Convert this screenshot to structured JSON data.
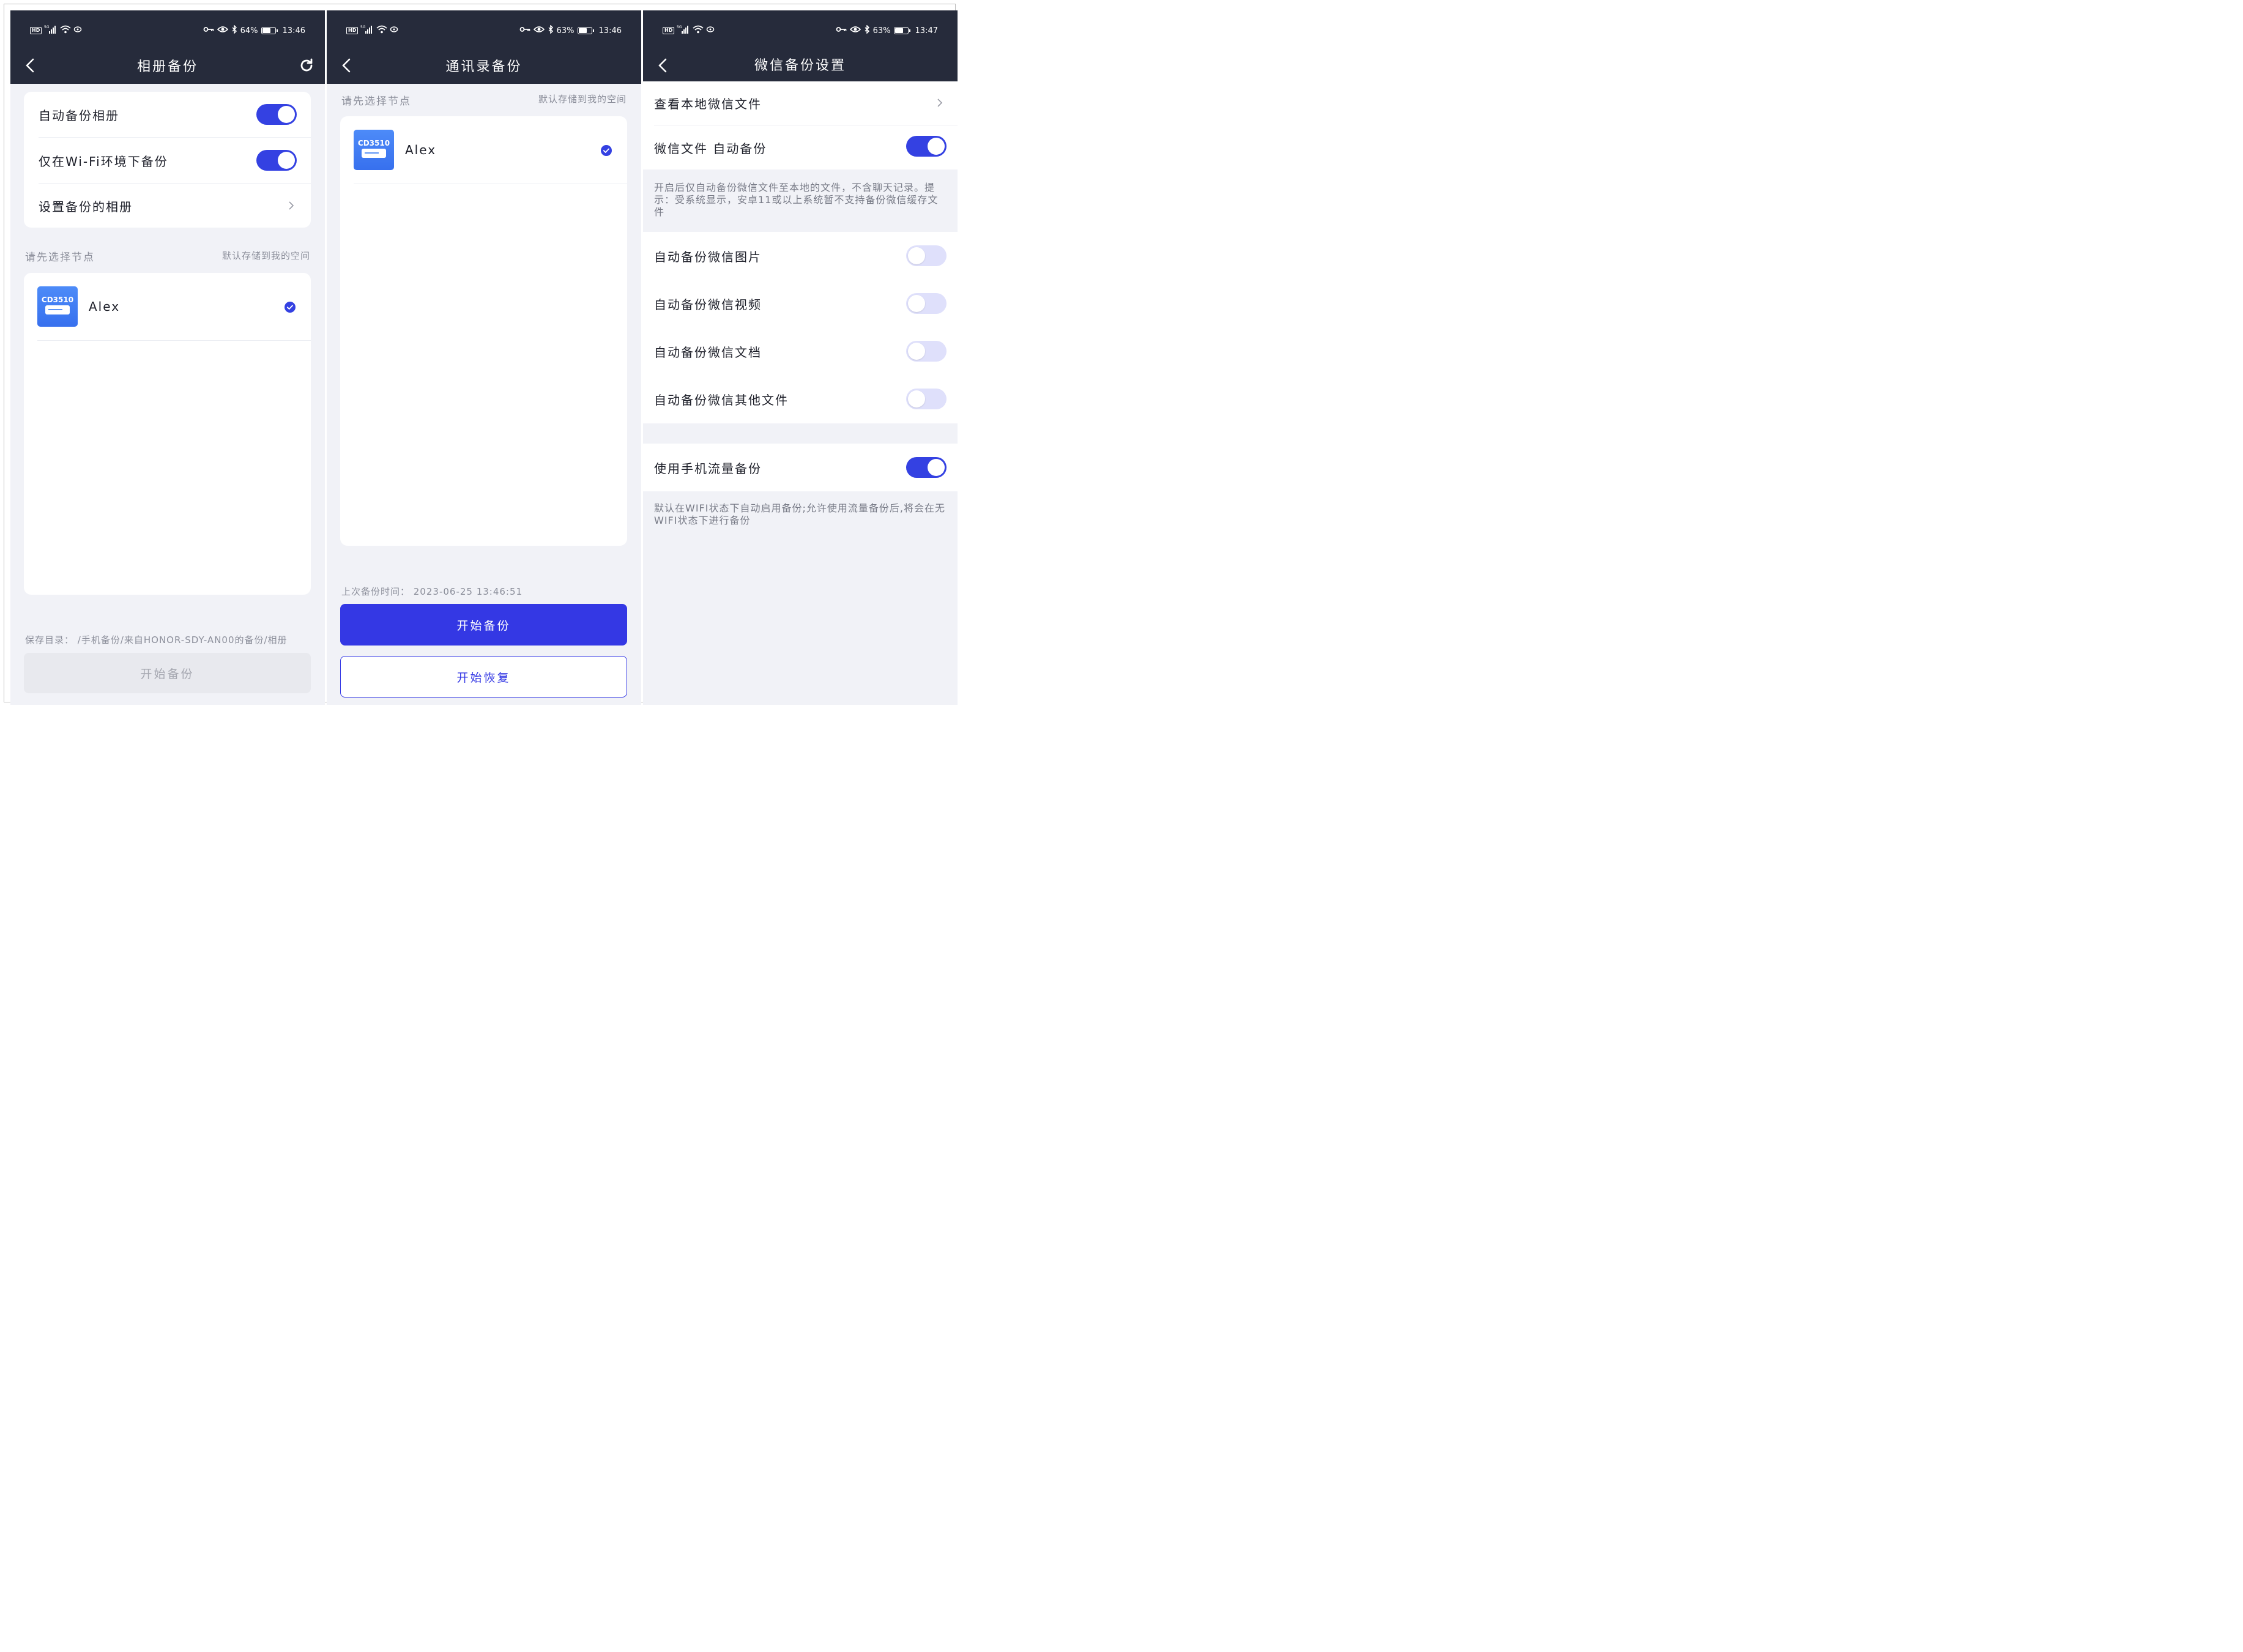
{
  "screens": [
    {
      "status": {
        "battery": "64%",
        "time": "13:46",
        "battery_level": 0.64
      },
      "title": "相册备份",
      "settings": [
        {
          "label": "自动备份相册",
          "toggle": true
        },
        {
          "label": "仅在Wi-Fi环境下备份",
          "toggle": true
        },
        {
          "label": "设置备份的相册"
        }
      ],
      "node_section": {
        "label": "请先选择节点",
        "hint": "默认存储到我的空间"
      },
      "node": {
        "icon_text": "CD3510",
        "name": "Alex",
        "selected": true
      },
      "save_dir": "保存目录： /手机备份/来自HONOR-SDY-AN00的备份/相册",
      "start_button": "开始备份"
    },
    {
      "status": {
        "battery": "63%",
        "time": "13:46",
        "battery_level": 0.63
      },
      "title": "通讯录备份",
      "node_section": {
        "label": "请先选择节点",
        "hint": "默认存储到我的空间"
      },
      "node": {
        "icon_text": "CD3510",
        "name": "Alex",
        "selected": true
      },
      "last_backup": "上次备份时间： 2023-06-25 13:46:51",
      "start_button": "开始备份",
      "restore_button": "开始恢复"
    },
    {
      "status": {
        "battery": "63%",
        "time": "13:47",
        "battery_level": 0.63
      },
      "title": "微信备份设置",
      "view_local": "查看本地微信文件",
      "auto_backup": {
        "label": "微信文件 自动备份",
        "toggle": true
      },
      "note1": "开启后仅自动备份微信文件至本地的文件，不含聊天记录。提示：受系统显示，安卓11或以上系统暂不支持备份微信缓存文件",
      "items": [
        {
          "label": "自动备份微信图片",
          "toggle": false
        },
        {
          "label": "自动备份微信视频",
          "toggle": false
        },
        {
          "label": "自动备份微信文档",
          "toggle": false
        },
        {
          "label": "自动备份微信其他文件",
          "toggle": false
        }
      ],
      "mobile_data": {
        "label": "使用手机流量备份",
        "toggle": true
      },
      "note2": "默认在WIFI状态下自动启用备份;允许使用流量备份后,将会在无WIFI状态下进行备份"
    }
  ],
  "colors": {
    "header": "#262b3b",
    "accent": "#3441e2",
    "background": "#f1f2f7"
  },
  "icons": [
    "hd-icon",
    "signal-icon",
    "wifi-icon",
    "nfc-icon",
    "key-icon",
    "eye-icon",
    "bluetooth-icon",
    "battery-icon",
    "back-icon",
    "refresh-icon",
    "chevron-right-icon",
    "check-circle-icon"
  ]
}
